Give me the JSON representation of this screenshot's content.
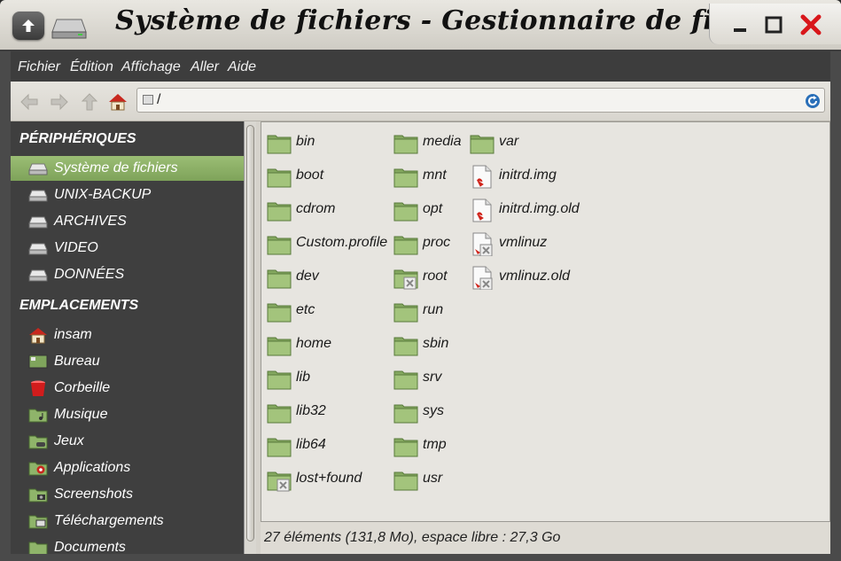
{
  "window": {
    "title": "Système de fichiers - Gestionnaire de fichiers"
  },
  "menu": [
    "Fichier",
    "Édition",
    "Affichage",
    "Aller",
    "Aide"
  ],
  "toolbar": {
    "path": "/"
  },
  "sidebar": {
    "devices_header": "PÉRIPHÉRIQUES",
    "devices": [
      {
        "label": "Système de fichiers",
        "icon": "drive-icon",
        "active": true
      },
      {
        "label": "UNIX-BACKUP",
        "icon": "drive-icon"
      },
      {
        "label": "ARCHIVES",
        "icon": "drive-icon"
      },
      {
        "label": "VIDEO",
        "icon": "drive-icon"
      },
      {
        "label": "DONNÉES",
        "icon": "drive-icon"
      }
    ],
    "places_header": "EMPLACEMENTS",
    "places": [
      {
        "label": "insam",
        "icon": "home-icon"
      },
      {
        "label": "Bureau",
        "icon": "desktop-icon"
      },
      {
        "label": "Corbeille",
        "icon": "trash-icon"
      },
      {
        "label": "Musique",
        "icon": "music-folder-icon"
      },
      {
        "label": "Jeux",
        "icon": "games-folder-icon"
      },
      {
        "label": "Applications",
        "icon": "applications-folder-icon"
      },
      {
        "label": "Screenshots",
        "icon": "screenshots-folder-icon"
      },
      {
        "label": "Téléchargements",
        "icon": "downloads-folder-icon"
      },
      {
        "label": "Documents",
        "icon": "documents-folder-icon"
      }
    ]
  },
  "files": {
    "col1": [
      {
        "name": "bin",
        "type": "folder"
      },
      {
        "name": "boot",
        "type": "folder"
      },
      {
        "name": "cdrom",
        "type": "folder"
      },
      {
        "name": "Custom.profile",
        "type": "folder"
      },
      {
        "name": "dev",
        "type": "folder"
      },
      {
        "name": "etc",
        "type": "folder"
      },
      {
        "name": "home",
        "type": "folder"
      },
      {
        "name": "lib",
        "type": "folder"
      },
      {
        "name": "lib32",
        "type": "folder"
      },
      {
        "name": "lib64",
        "type": "folder"
      },
      {
        "name": "lost+found",
        "type": "folder-locked"
      }
    ],
    "col2": [
      {
        "name": "media",
        "type": "folder"
      },
      {
        "name": "mnt",
        "type": "folder"
      },
      {
        "name": "opt",
        "type": "folder"
      },
      {
        "name": "proc",
        "type": "folder"
      },
      {
        "name": "root",
        "type": "folder-locked"
      },
      {
        "name": "run",
        "type": "folder"
      },
      {
        "name": "sbin",
        "type": "folder"
      },
      {
        "name": "srv",
        "type": "folder"
      },
      {
        "name": "sys",
        "type": "folder"
      },
      {
        "name": "tmp",
        "type": "folder"
      },
      {
        "name": "usr",
        "type": "folder"
      }
    ],
    "col3": [
      {
        "name": "var",
        "type": "folder"
      },
      {
        "name": "initrd.img",
        "type": "link"
      },
      {
        "name": "initrd.img.old",
        "type": "link"
      },
      {
        "name": "vmlinuz",
        "type": "link-broken"
      },
      {
        "name": "vmlinuz.old",
        "type": "link-broken"
      }
    ]
  },
  "status": {
    "text": "27 éléments (131,8 Mo), espace libre : 27,3 Go"
  }
}
